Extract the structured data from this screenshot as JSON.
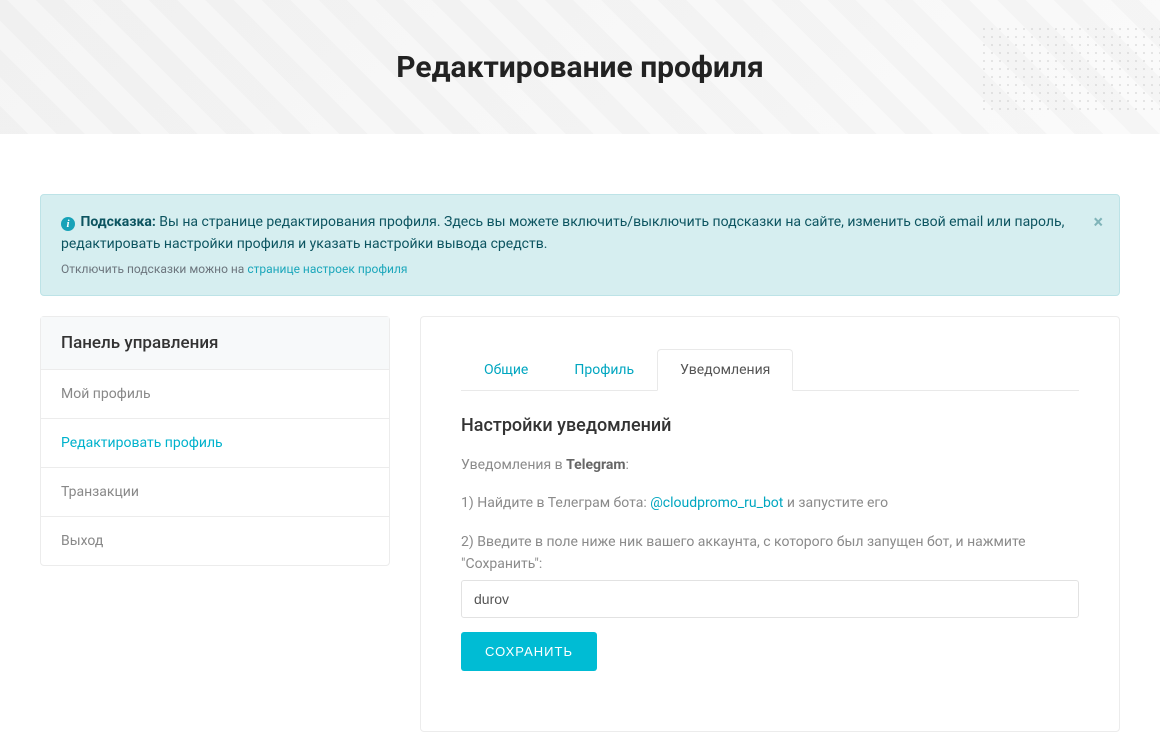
{
  "header": {
    "title": "Редактирование профиля"
  },
  "alert": {
    "label": "Подсказка:",
    "text": "Вы на странице редактирования профиля. Здесь вы можете включить/выключить подсказки на сайте, изменить свой email или пароль, редактировать настройки профиля и указать настройки вывода средств.",
    "sub_prefix": "Отключить подсказки можно на ",
    "sub_link": "странице настроек профиля"
  },
  "sidebar": {
    "title": "Панель управления",
    "items": [
      {
        "label": "Мой профиль",
        "active": false
      },
      {
        "label": "Редактировать профиль",
        "active": true
      },
      {
        "label": "Транзакции",
        "active": false
      },
      {
        "label": "Выход",
        "active": false
      }
    ]
  },
  "tabs": [
    {
      "label": "Общие",
      "active": false
    },
    {
      "label": "Профиль",
      "active": false
    },
    {
      "label": "Уведомления",
      "active": true
    }
  ],
  "notifications": {
    "title": "Настройки уведомлений",
    "line1_pre": "Уведомления в ",
    "line1_bold": "Telegram",
    "line1_post": ":",
    "step1_pre": "1) Найдите в Телеграм бота: ",
    "step1_link": "@cloudpromo_ru_bot",
    "step1_post": " и запустите его",
    "step2": "2) Введите в поле ниже ник вашего аккаунта, с которого был запущен бот, и нажмите \"Сохранить\":",
    "input_value": "durov",
    "save_button": "СОХРАНИТЬ"
  }
}
